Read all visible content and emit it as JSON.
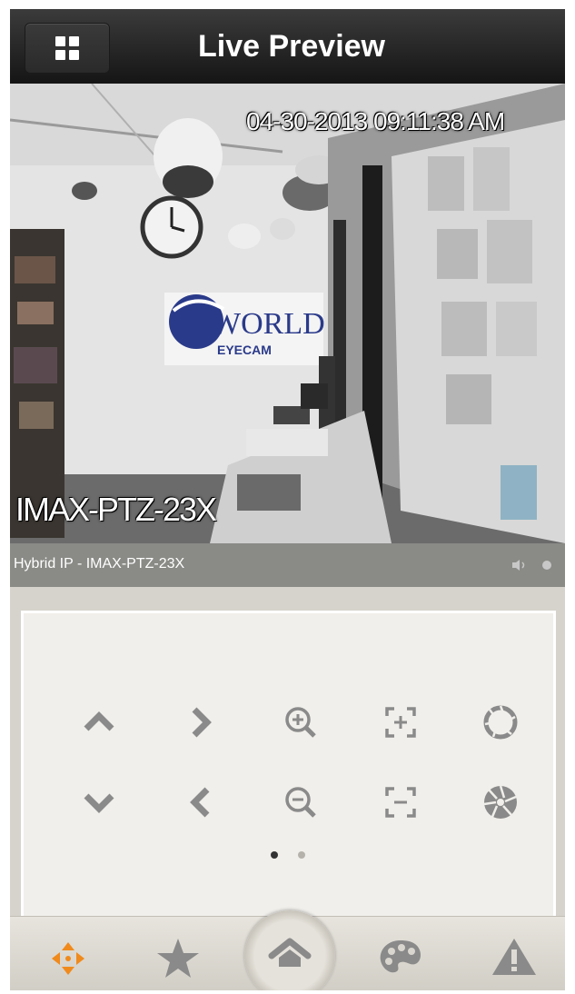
{
  "header": {
    "title": "Live Preview",
    "menu_icon": "grid-icon"
  },
  "video": {
    "timestamp": "04-30-2013 09:11:38 AM",
    "camera_overlay": "IMAX-PTZ-23X",
    "wall_logo": "WORLD EYECAM"
  },
  "status_bar": {
    "channel_label": "Hybrid IP - IMAX-PTZ-23X",
    "icons": [
      "audio-icon",
      "record-indicator-icon"
    ]
  },
  "ptz_controls": {
    "row1": [
      "tilt-up-icon",
      "pan-right-icon",
      "zoom-in-icon",
      "focus-near-icon",
      "iris-open-icon"
    ],
    "row2": [
      "tilt-down-icon",
      "pan-left-icon",
      "zoom-out-icon",
      "focus-far-icon",
      "iris-close-icon"
    ],
    "page_index": 1,
    "page_count": 2
  },
  "tabbar": {
    "tabs": [
      "ptz-icon",
      "favorites-star-icon",
      "home-icon",
      "palette-icon",
      "alert-icon"
    ],
    "active_tab": "ptz-icon"
  },
  "colors": {
    "accent": "#f08a1c",
    "header_bg": "#1e1e1e",
    "icon_gray": "#8a8a8a"
  }
}
